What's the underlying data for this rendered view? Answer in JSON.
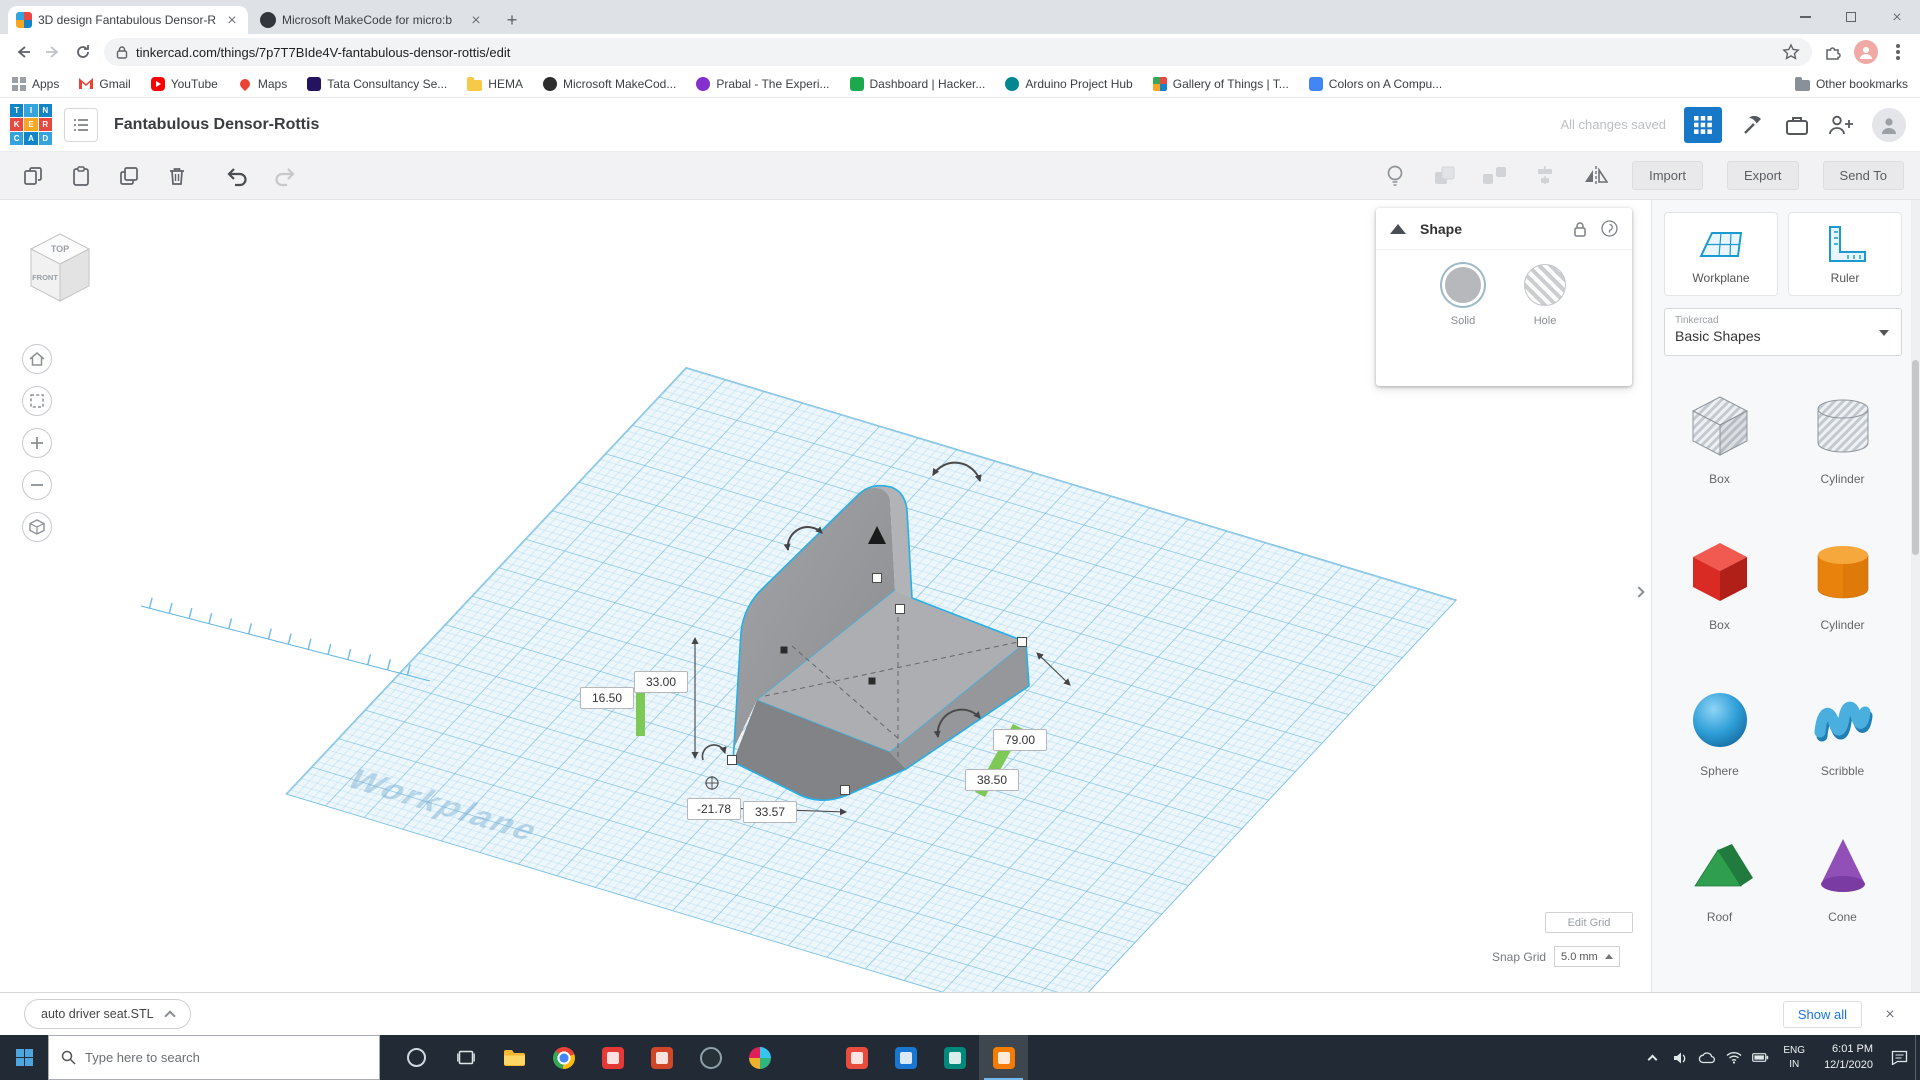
{
  "browser": {
    "tab1": "3D design Fantabulous Densor-R",
    "tab2": "Microsoft MakeCode for micro:b",
    "url": "tinkercad.com/things/7p7T7BIde4V-fantabulous-densor-rottis/edit",
    "bookmarks": [
      "Apps",
      "Gmail",
      "YouTube",
      "Maps",
      "Tata Consultancy Se...",
      "HEMA",
      "Microsoft MakeCod...",
      "Prabal - The Experi...",
      "Dashboard | Hacker...",
      "Arduino Project Hub",
      "Gallery of Things | T...",
      "Colors on A Compu..."
    ],
    "other_bookmarks": "Other bookmarks"
  },
  "header": {
    "logo": [
      "T",
      "I",
      "N",
      "K",
      "E",
      "R",
      "C",
      "A",
      "D"
    ],
    "title": "Fantabulous Densor-Rottis",
    "status": "All changes saved"
  },
  "toolbar": {
    "import": "Import",
    "export": "Export",
    "send_to": "Send To"
  },
  "viewcube": {
    "top": "TOP",
    "front": "FRONT"
  },
  "shape_panel": {
    "title": "Shape",
    "solid": "Solid",
    "hole": "Hole"
  },
  "scene": {
    "watermark": "Workplane",
    "dim_height": "33.00",
    "dim_elev": "16.50",
    "dim_length": "79.00",
    "dim_width": "38.50",
    "dim_x": "-21.78",
    "dim_y": "33.57"
  },
  "sidebar": {
    "workplane": "Workplane",
    "ruler": "Ruler",
    "brand": "Tinkercad",
    "category": "Basic Shapes",
    "shapes": [
      {
        "label": "Box",
        "variant": "gray-striped"
      },
      {
        "label": "Cylinder",
        "variant": "gray-striped"
      },
      {
        "label": "Box",
        "variant": "red"
      },
      {
        "label": "Cylinder",
        "variant": "orange"
      },
      {
        "label": "Sphere",
        "variant": "blue"
      },
      {
        "label": "Scribble",
        "variant": "blue"
      },
      {
        "label": "Roof",
        "variant": "green"
      },
      {
        "label": "Cone",
        "variant": "purple"
      }
    ]
  },
  "grid": {
    "edit": "Edit Grid",
    "snap_label": "Snap Grid",
    "snap_value": "5.0 mm"
  },
  "downloads": {
    "filename": "auto driver seat.STL",
    "show_all": "Show all"
  },
  "taskbar": {
    "search": "Type here to search",
    "lang": "ENG",
    "region": "IN",
    "time": "6:01 PM",
    "date": "12/1/2020"
  },
  "colors": {
    "accent_blue": "#1b9ad2",
    "selection_cyan": "#25b0e8",
    "handle_green": "#7ec855"
  }
}
